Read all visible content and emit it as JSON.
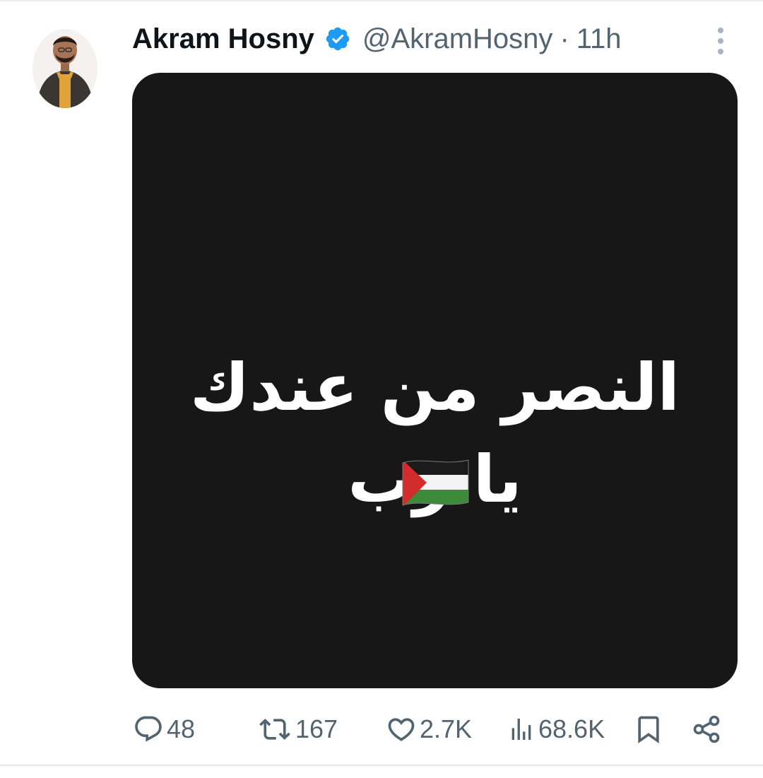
{
  "tweet": {
    "author": {
      "display_name": "Akram Hosny",
      "handle": "@AkramHosny",
      "verified": true
    },
    "separator": "·",
    "timestamp": "11h",
    "media": {
      "line1": "النصر من عندك",
      "line2": "يا رب",
      "emoji": "palestine-flag"
    },
    "metrics": {
      "replies": "48",
      "reposts": "167",
      "likes": "2.7K",
      "views": "68.6K"
    }
  },
  "colors": {
    "verified_blue": "#1d9bf0",
    "secondary_text": "#536471",
    "media_background": "#171717"
  }
}
